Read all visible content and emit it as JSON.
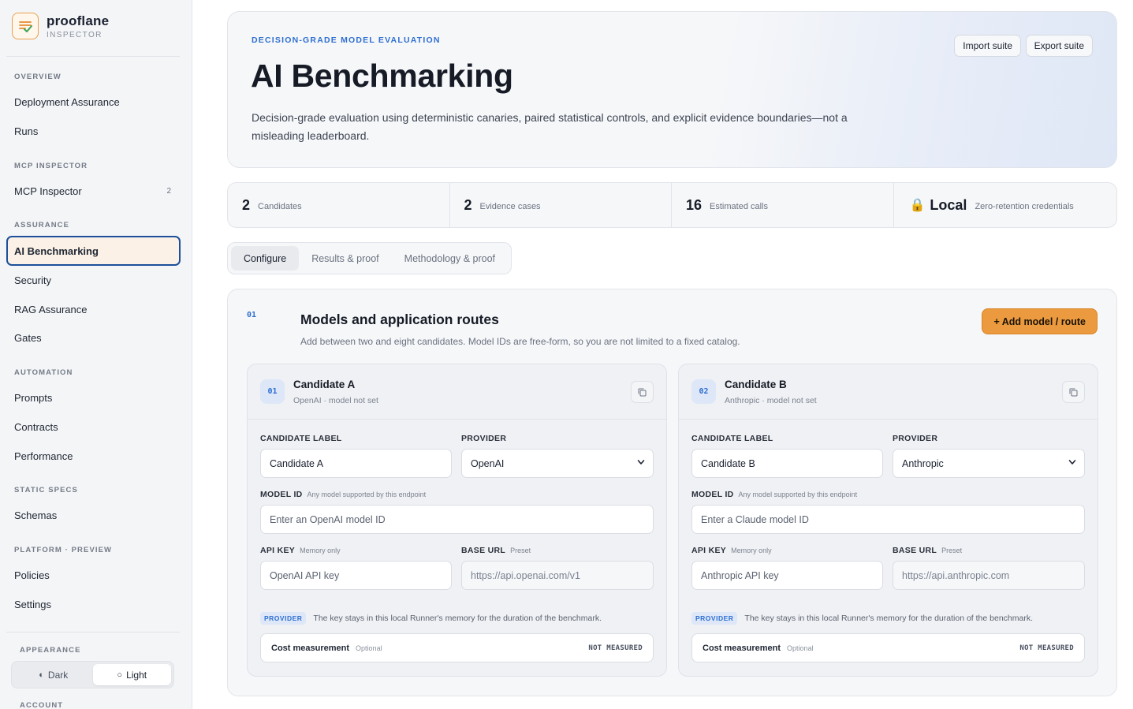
{
  "brand": {
    "name": "prooflane",
    "subtitle": "INSPECTOR"
  },
  "sidebar": {
    "sections": [
      {
        "label": "OVERVIEW"
      },
      {
        "label": "MCP INSPECTOR"
      },
      {
        "label": "ASSURANCE"
      },
      {
        "label": "AUTOMATION"
      },
      {
        "label": "STATIC SPECS"
      },
      {
        "label": "PLATFORM · PREVIEW"
      },
      {
        "label": "APPEARANCE"
      },
      {
        "label": "ACCOUNT"
      }
    ],
    "items": [
      {
        "label": "Deployment Assurance"
      },
      {
        "label": "Runs"
      },
      {
        "label": "MCP Inspector",
        "count": "2"
      },
      {
        "label": "AI Benchmarking"
      },
      {
        "label": "Security"
      },
      {
        "label": "RAG Assurance"
      },
      {
        "label": "Gates"
      },
      {
        "label": "Prompts"
      },
      {
        "label": "Contracts"
      },
      {
        "label": "Performance"
      },
      {
        "label": "Schemas"
      },
      {
        "label": "Policies"
      },
      {
        "label": "Settings"
      }
    ],
    "appearance": {
      "dark": "Dark",
      "light": "Light",
      "selected": "Light"
    }
  },
  "hero": {
    "eyebrow": "DECISION-GRADE MODEL EVALUATION",
    "title": "AI Benchmarking",
    "description": "Decision-grade evaluation using deterministic canaries, paired statistical controls, and explicit evidence boundaries—not a misleading leaderboard.",
    "import_label": "Import suite",
    "export_label": "Export suite"
  },
  "stats": [
    {
      "value": "2",
      "label": "Candidates"
    },
    {
      "value": "2",
      "label": "Evidence cases"
    },
    {
      "value": "16",
      "label": "Estimated calls"
    },
    {
      "value": "Local",
      "label": "Zero-retention credentials"
    }
  ],
  "tabs": [
    {
      "label": "Configure"
    },
    {
      "label": "Results & proof"
    },
    {
      "label": "Methodology & proof"
    }
  ],
  "panel": {
    "step": "01",
    "title": "Models and application routes",
    "subtitle": "Add between two and eight candidates. Model IDs are free-form, so you are not limited to a fixed catalog.",
    "add_label": "+ Add model / route"
  },
  "labels": {
    "candidate_label": "CANDIDATE LABEL",
    "provider": "PROVIDER",
    "model_id": "MODEL ID",
    "model_hint": "Any model supported by this endpoint",
    "api_key": "API KEY",
    "api_hint": "Memory only",
    "base_url": "BASE URL",
    "base_hint": "Preset",
    "pill": "PROVIDER",
    "note": "The key stays in this local Runner's memory for the duration of the benchmark.",
    "cost": "Cost measurement",
    "cost_opt": "Optional",
    "cost_status": "NOT MEASURED"
  },
  "candidates": [
    {
      "badge": "01",
      "title": "Candidate A",
      "subtitle": "OpenAI · model not set",
      "label_value": "Candidate A",
      "provider": "OpenAI",
      "model_placeholder": "Enter an OpenAI model ID",
      "api_placeholder": "OpenAI API key",
      "base_url": "https://api.openai.com/v1"
    },
    {
      "badge": "02",
      "title": "Candidate B",
      "subtitle": "Anthropic · model not set",
      "label_value": "Candidate B",
      "provider": "Anthropic",
      "model_placeholder": "Enter a Claude model ID",
      "api_placeholder": "Anthropic API key",
      "base_url": "https://api.anthropic.com"
    }
  ],
  "colors": {
    "accent": "#2e6fd1",
    "cta": "#ec9a3f",
    "active_border": "#1d4f9a"
  }
}
